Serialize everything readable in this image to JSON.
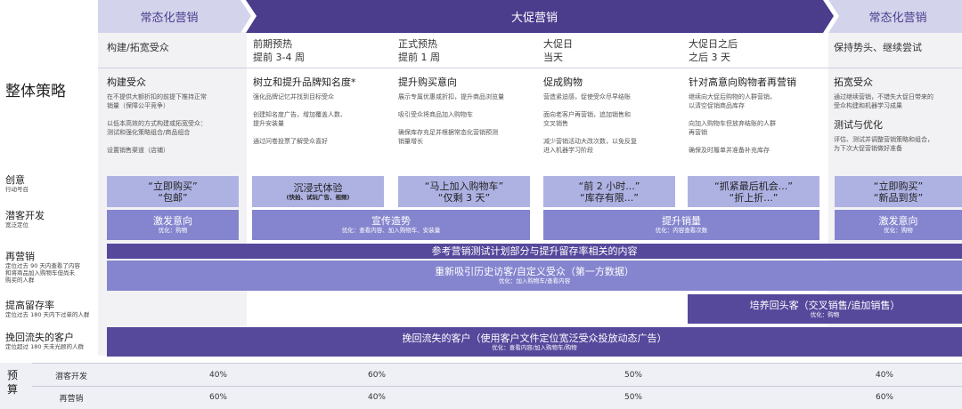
{
  "phases": {
    "normal_left": "常态化营销",
    "promo": "大促营销",
    "normal_right": "常态化营销"
  },
  "subheads": [
    "构建/拓宽受众",
    "前期预热\n提前 3-4 周",
    "正式预热\n提前 1 周",
    "大促日\n当天",
    "大促日之后\n之后 3 天",
    "保持势头、继续尝试"
  ],
  "overall_label": "整体策略",
  "strategies": [
    {
      "title": "构建受众",
      "body": "在不提供大额折扣的前提下推持正常\n销量（保障公平竞争）\n\n以低本高效的方式构建或拓宽受众：\n测试和强化策略组合/商品组合\n\n设置销售渠道（店铺）"
    },
    {
      "title": "树立和提升品牌知名度*",
      "body": "强化品牌记忆并找到目标受众\n\n创建知名度广告，增加覆盖人数、\n提升安装量\n\n通过问卷投票了解受众喜好"
    },
    {
      "title": "提升购买意向",
      "body": "展示专属优惠或折扣，提升商品浏览量\n\n吸引受众将商品加入购物车\n\n确保库存充足并根据常态化营销预测\n销量增长"
    },
    {
      "title": "促成购物",
      "body": "营造紧迫感，促使受众尽早结账\n\n面向老客户再营销，追加销售和\n交叉销售\n\n减少营销活动大改次数，以免反复\n进入机器学习阶段"
    },
    {
      "title": "针对高意向购物者再营销",
      "body": "继续向大促后购物的人群营销，\n以清空促销商品库存\n\n向加入购物车但放弃结账的人群\n再营销\n\n确保及时履单并准备补充库存"
    },
    {
      "title": "拓宽受众",
      "body": "通过继续营销，不错失大促日带来的\n受众构建和机器学习成果"
    },
    {
      "title": "测试与优化",
      "body": "评估、测试并调整营销策略和组合，\n为下次大促营销做好准备"
    }
  ],
  "row_labels": [
    {
      "main": "创意",
      "sub": "行动号召"
    },
    {
      "main": "潜客开发",
      "sub": "宽泛定位"
    },
    {
      "main": "再营销",
      "sub": "定位过去 90 天内查看了内容\n和将商品加入购物车但尚未\n购买的人群"
    },
    {
      "main": "提高留存率",
      "sub": "定位过去 180 天内下过单的人群"
    },
    {
      "main": "挽回流失的客户",
      "sub": "定位超过 180 天未光顾的人群"
    }
  ],
  "creative": [
    "“立即购买”\n“包邮”",
    "沉浸式体验",
    "“马上加入购物车”\n“仅剩 3 天”",
    "“前 2 小时...”\n“库存有限...”",
    "“抓紧最后机会...”\n“折上折...”",
    "“立即购买”\n“新品到货”"
  ],
  "creative_sub": "(快拍、试玩广告、视频)",
  "prospecting": [
    {
      "title": "激发意向",
      "sub": "优化：购物"
    },
    {
      "title": "宣传造势",
      "sub": "优化：查看内容、加入购物车、安装量"
    },
    {
      "title": "提升销量",
      "sub": "优化：内容查看次数"
    },
    {
      "title": "激发意向",
      "sub": "优化：购物"
    }
  ],
  "remarketing_top": "参考营销测试计划部分与提升留存率相关的内容",
  "remarketing_main": {
    "title": "重新吸引历史访客/自定义受众（第一方数据）",
    "sub": "优化：加入购物车/查看内容"
  },
  "retention": {
    "title": "培养回头客（交叉销售/追加销售）",
    "sub": "优化：购物"
  },
  "winback": {
    "title": "挽回流失的客户（使用客户文件定位宽泛受众投放动态广告）",
    "sub": "优化：查看内容/加入购物车/购物"
  },
  "budget": {
    "label": "预\n算",
    "rows": [
      {
        "name": "潜客开发",
        "values": [
          "40%",
          "60%",
          "50%",
          "40%"
        ]
      },
      {
        "name": "再营销",
        "values": [
          "60%",
          "40%",
          "50%",
          "60%"
        ]
      }
    ]
  },
  "colors": {
    "promo": "#4b3c8c",
    "normal": "#d3d4ec",
    "light": "#aeb2e3",
    "mid": "#8585cf",
    "dark": "#56489b"
  }
}
